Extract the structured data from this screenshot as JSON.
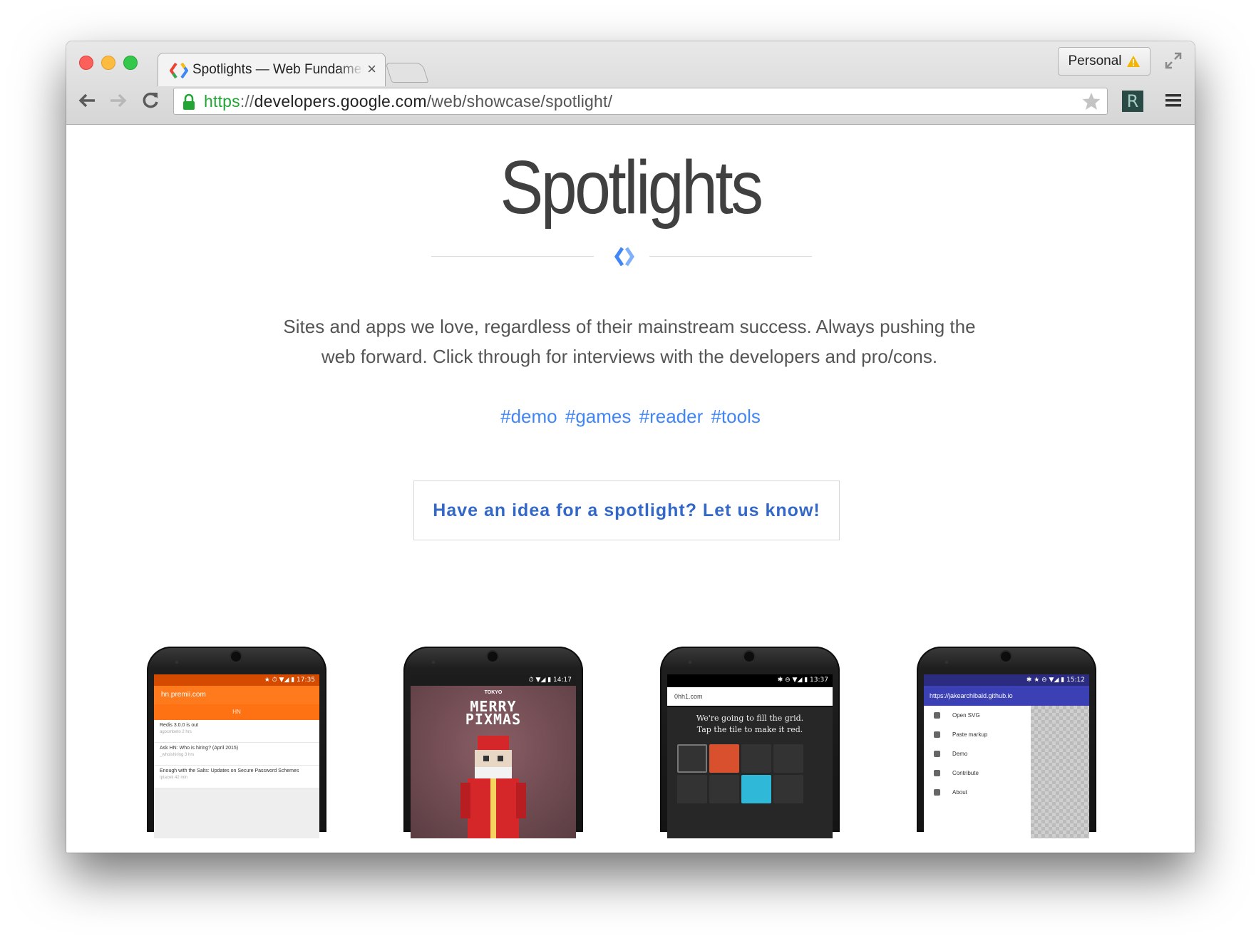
{
  "browser": {
    "tab_title": "Spotlights — Web Fundamentals",
    "tab_close": "×",
    "profile_label": "Personal",
    "url": {
      "scheme": "https",
      "separator": "://",
      "host": "developers.google.com",
      "path": "/web/showcase/spotlight/"
    },
    "extension_label": "R",
    "icons": [
      "back-icon",
      "forward-icon",
      "reload-icon",
      "lock-icon",
      "star-icon",
      "menu-icon",
      "fullscreen-icon",
      "warning-icon"
    ]
  },
  "page": {
    "title": "Spotlights",
    "intro": "Sites and apps we love, regardless of their mainstream success. Always pushing the web forward. Click through for interviews with the developers and pro/cons.",
    "tags": [
      "#demo",
      "#games",
      "#reader",
      "#tools"
    ],
    "cta_label": "Have an idea for a spotlight? Let us know!"
  },
  "phones": {
    "hn": {
      "status": "★ ⏱ ▼◢ ▮ 17:35",
      "url": "hn.premii.com",
      "tab": "HN",
      "items": [
        {
          "title": "Redis 3.0.0 is out",
          "meta": "agocmbeto  2 hrs"
        },
        {
          "title": "Ask HN: Who is hiring? (April 2015)",
          "meta": "_whoishiring  3 hrs"
        },
        {
          "title": "Enough with the Salts: Updates on Secure Password Schemes",
          "meta": "tptacek  42 min"
        }
      ]
    },
    "pixmas": {
      "status": "⏱ ▼◢ ▮ 14:17",
      "subtitle": "TOKYO",
      "title_line1": "MERRY",
      "title_line2": "PIXMAS"
    },
    "ohhi": {
      "status": "✱ ⊖ ▼◢ ▮ 13:37",
      "url": "0hh1.com",
      "message_line1": "We're going to fill the grid.",
      "message_line2": "Tap the tile to make it red."
    },
    "svgomg": {
      "status": "✱ ★ ⊖ ▼◢ ▮ 15:12",
      "url": "https://jakearchibald.github.io",
      "menu": [
        "Open SVG",
        "Paste markup",
        "Demo",
        "Contribute",
        "About"
      ]
    }
  },
  "colors": {
    "link": "#4285f4",
    "cta_text": "#3468c8",
    "url_scheme": "#22a535",
    "hn_orange": "#ff7a1c",
    "svgomg_blue": "#3b40b4",
    "ohhi_red": "#d9502f",
    "ohhi_blue": "#30b8d8"
  }
}
